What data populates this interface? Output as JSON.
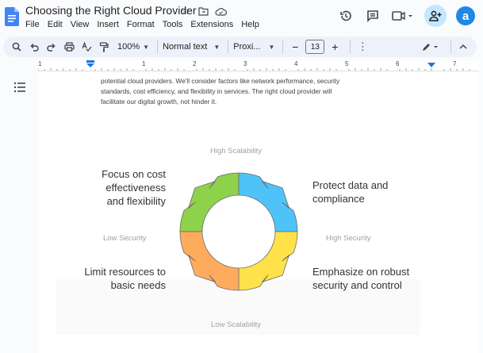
{
  "document": {
    "title": "Choosing the Right Cloud Provider"
  },
  "menu": [
    "File",
    "Edit",
    "View",
    "Insert",
    "Format",
    "Tools",
    "Extensions",
    "Help"
  ],
  "user": {
    "avatar_letter": "a"
  },
  "toolbar": {
    "zoom": "100%",
    "style": "Normal text",
    "font": "Proxi...",
    "font_size": "13",
    "minus": "−",
    "plus": "+"
  },
  "ruler": [
    "1",
    "1",
    "2",
    "3",
    "4",
    "5",
    "6",
    "7"
  ],
  "body": {
    "lines": [
      "potential cloud providers. We'll consider factors like network performance, security",
      "standards, cost efficiency, and flexibility in services. The right cloud provider will",
      "facilitate our digital growth, not hinder it."
    ]
  },
  "diagram": {
    "top_axis": "High Scalability",
    "bottom_axis": "Low Scalability",
    "left_axis": "Low Security",
    "right_axis": "High Security",
    "top_left": [
      "Focus on cost",
      "effectiveness",
      "and flexibility"
    ],
    "top_right": [
      "Protect data and",
      "compliance"
    ],
    "bottom_left": [
      "Limit resources to",
      "basic needs"
    ],
    "bottom_right": [
      "Emphasize on robust",
      "security and control"
    ],
    "colors": {
      "top_left": "#8ed14a",
      "top_right": "#4fc3f7",
      "bottom_left": "#ffab5e",
      "bottom_right": "#ffe24a"
    }
  }
}
